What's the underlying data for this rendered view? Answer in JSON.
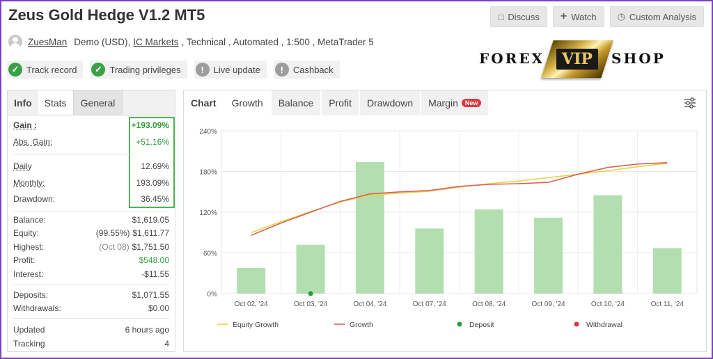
{
  "header": {
    "title": "Zeus Gold Hedge V1.2 MT5",
    "buttons": [
      {
        "label": "Discuss",
        "icon": "chat-icon"
      },
      {
        "label": "Watch",
        "icon": "plus-icon"
      },
      {
        "label": "Custom Analysis",
        "icon": "clock-icon"
      }
    ]
  },
  "meta": {
    "user": "ZuesMan",
    "account": "Demo (USD),",
    "broker": "IC Markets",
    "rest": ", Technical , Automated , 1:500 , MetaTrader 5"
  },
  "statuses": [
    {
      "label": "Track record",
      "state": "ok"
    },
    {
      "label": "Trading privileges",
      "state": "ok"
    },
    {
      "label": "Live update",
      "state": "warn"
    },
    {
      "label": "Cashback",
      "state": "warn"
    }
  ],
  "logo": {
    "left": "FOREX",
    "badge": "VIP",
    "right": "SHOP"
  },
  "left_tabs": [
    "Info",
    "Stats",
    "General"
  ],
  "stats": {
    "gain_label": "Gain :",
    "gain_value": "+193.09%",
    "abs_gain_label": "Abs. Gain:",
    "abs_gain_value": "+51.16%",
    "daily_label": "Daily",
    "daily_value": "12.69%",
    "monthly_label": "Monthly:",
    "monthly_value": "193.09%",
    "drawdown_label": "Drawdown:",
    "drawdown_value": "36.45%",
    "balance_label": "Balance:",
    "balance_value": "$1,619.05",
    "equity_label": "Equity:",
    "equity_pct": "(99.55%)",
    "equity_value": "$1,611.77",
    "highest_label": "Highest:",
    "highest_date": "(Oct 08)",
    "highest_value": "$1,751.50",
    "profit_label": "Profit:",
    "profit_value": "$548.00",
    "interest_label": "Interest:",
    "interest_value": "-$11.55",
    "deposits_label": "Deposits:",
    "deposits_value": "$1,071.55",
    "withdrawals_label": "Withdrawals:",
    "withdrawals_value": "$0.00",
    "updated_label": "Updated",
    "updated_value": "6 hours ago",
    "tracking_label": "Tracking",
    "tracking_value": "4"
  },
  "chart_tabs": [
    {
      "label": "Chart",
      "kind": "chart"
    },
    {
      "label": "Growth",
      "kind": "active"
    },
    {
      "label": "Balance",
      "kind": ""
    },
    {
      "label": "Profit",
      "kind": ""
    },
    {
      "label": "Drawdown",
      "kind": ""
    },
    {
      "label": "Margin",
      "kind": "",
      "badge": "New"
    }
  ],
  "chart_data": {
    "type": "bar",
    "categories": [
      "Oct 02, '24",
      "Oct 03, '24",
      "Oct 04, '24",
      "Oct 07, '24",
      "Oct 08, '24",
      "Oct 09, '24",
      "Oct 10, '24",
      "Oct 11, '24"
    ],
    "yticks": [
      "0%",
      "60%",
      "120%",
      "180%",
      "240%"
    ],
    "ylim": [
      0,
      240
    ],
    "bars": [
      38,
      72,
      194,
      96,
      124,
      112,
      145,
      67
    ],
    "series": [
      {
        "name": "Equity Growth",
        "color": "#e6d34a",
        "x": [
          0,
          0.5,
          1,
          1.5,
          2,
          2.5,
          3,
          3.5,
          4,
          4.5,
          5,
          5.5,
          6,
          6.5,
          7
        ],
        "values": [
          90,
          106,
          121,
          135,
          145,
          148,
          151,
          157,
          162,
          166,
          171,
          176,
          181,
          187,
          192
        ]
      },
      {
        "name": "Growth",
        "color": "#d9605a",
        "x": [
          0,
          0.5,
          1,
          1.5,
          2,
          2.5,
          3,
          3.5,
          4,
          4.5,
          5,
          5.5,
          6,
          6.5,
          7
        ],
        "values": [
          86,
          104,
          120,
          136,
          147,
          150,
          152,
          158,
          161,
          162,
          164,
          176,
          186,
          191,
          193
        ]
      }
    ],
    "deposit_marker": {
      "category_index": 1,
      "value": 0,
      "color": "#2e9b3b"
    },
    "legend": [
      {
        "label": "Equity Growth",
        "type": "line",
        "color": "#e6d34a"
      },
      {
        "label": "Growth",
        "type": "line",
        "color": "#d9605a"
      },
      {
        "label": "Deposit",
        "type": "dot",
        "color": "#2e9b3b"
      },
      {
        "label": "Withdrawal",
        "type": "dot",
        "color": "#d43c3c"
      }
    ],
    "bar_color": "#b3dfb0",
    "grid": true
  }
}
